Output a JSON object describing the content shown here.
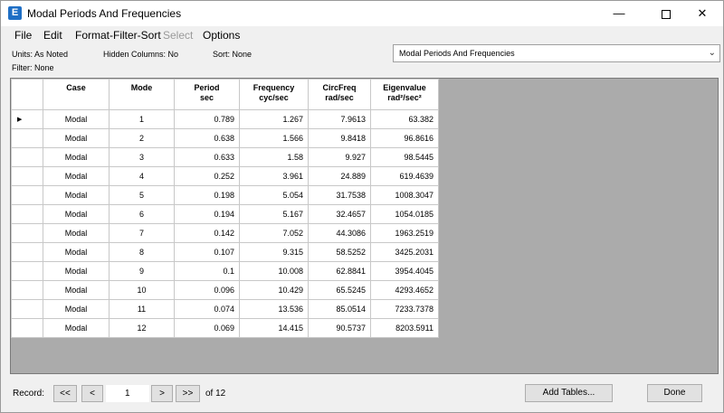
{
  "window": {
    "app_icon": "E",
    "title": "Modal Periods And Frequencies",
    "minimize_glyph": "—",
    "close_glyph": "✕"
  },
  "menu": [
    "File",
    "Edit",
    "Format-Filter-Sort",
    "Select",
    "Options"
  ],
  "info": {
    "units": "Units:  As Noted",
    "hidden_columns": "Hidden Columns:  No",
    "sort": "Sort:  None",
    "filter": "Filter:  None"
  },
  "table_selector": {
    "selected": "Modal Periods And Frequencies",
    "arrow": "⌄"
  },
  "table": {
    "headers": [
      {
        "line1": "Case",
        "line2": ""
      },
      {
        "line1": "Mode",
        "line2": ""
      },
      {
        "line1": "Period",
        "line2": "sec"
      },
      {
        "line1": "Frequency",
        "line2": "cyc/sec"
      },
      {
        "line1": "CircFreq",
        "line2": "rad/sec"
      },
      {
        "line1": "Eigenvalue",
        "line2": "rad²/sec²"
      }
    ],
    "current_row_marker": "▶",
    "rows": [
      [
        "Modal",
        "1",
        "0.789",
        "1.267",
        "7.9613",
        "63.382"
      ],
      [
        "Modal",
        "2",
        "0.638",
        "1.566",
        "9.8418",
        "96.8616"
      ],
      [
        "Modal",
        "3",
        "0.633",
        "1.58",
        "9.927",
        "98.5445"
      ],
      [
        "Modal",
        "4",
        "0.252",
        "3.961",
        "24.889",
        "619.4639"
      ],
      [
        "Modal",
        "5",
        "0.198",
        "5.054",
        "31.7538",
        "1008.3047"
      ],
      [
        "Modal",
        "6",
        "0.194",
        "5.167",
        "32.4657",
        "1054.0185"
      ],
      [
        "Modal",
        "7",
        "0.142",
        "7.052",
        "44.3086",
        "1963.2519"
      ],
      [
        "Modal",
        "8",
        "0.107",
        "9.315",
        "58.5252",
        "3425.2031"
      ],
      [
        "Modal",
        "9",
        "0.1",
        "10.008",
        "62.8841",
        "3954.4045"
      ],
      [
        "Modal",
        "10",
        "0.096",
        "10.429",
        "65.5245",
        "4293.4652"
      ],
      [
        "Modal",
        "11",
        "0.074",
        "13.536",
        "85.0514",
        "7233.7378"
      ],
      [
        "Modal",
        "12",
        "0.069",
        "14.415",
        "90.5737",
        "8203.5911"
      ]
    ]
  },
  "record_nav": {
    "label": "Record:",
    "first": "<<",
    "prev": "<",
    "current": "1",
    "next": ">",
    "last": ">>",
    "total": "of 12"
  },
  "buttons": {
    "add_tables": "Add Tables...",
    "done": "Done"
  }
}
